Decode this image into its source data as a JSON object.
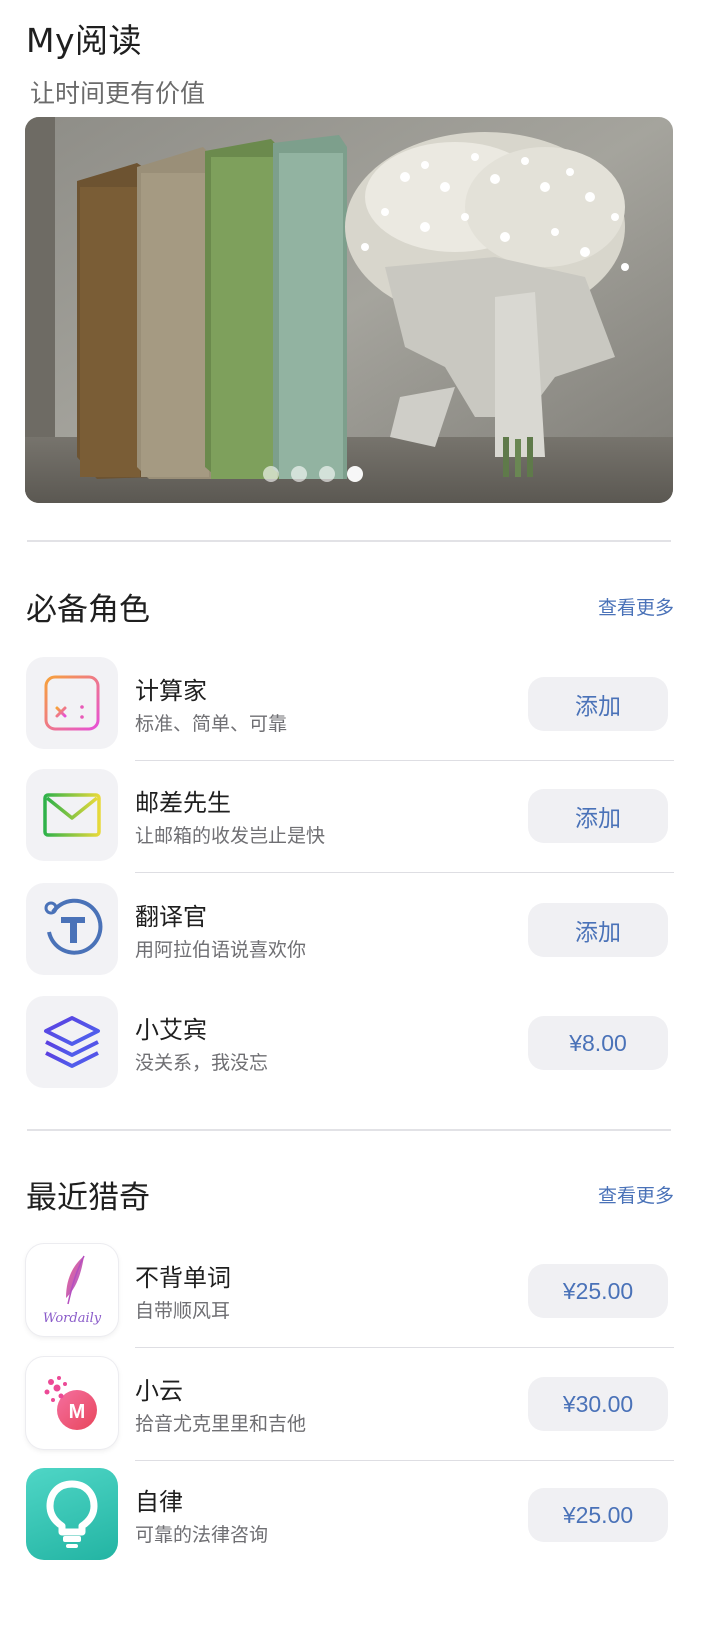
{
  "header": {
    "title": "My阅读",
    "subtitle": "让时间更有价值"
  },
  "banner": {
    "slides": 4,
    "active_slide": 4
  },
  "sections": [
    {
      "title": "必备角色",
      "more_label": "查看更多",
      "items": [
        {
          "name": "计算家",
          "desc": "标准、简单、可靠",
          "button": "添加",
          "icon": "calculator-icon"
        },
        {
          "name": "邮差先生",
          "desc": "让邮箱的收发岂止是快",
          "button": "添加",
          "icon": "mail-icon"
        },
        {
          "name": "翻译官",
          "desc": "用阿拉伯语说喜欢你",
          "button": "添加",
          "icon": "translate-icon"
        },
        {
          "name": "小艾宾",
          "desc": "没关系，我没忘",
          "button": "¥8.00",
          "icon": "layers-icon"
        }
      ]
    },
    {
      "title": "最近猎奇",
      "more_label": "查看更多",
      "items": [
        {
          "name": "不背单词",
          "desc": "自带顺风耳",
          "button": "¥25.00",
          "icon": "feather-icon",
          "logo_text": "Wordaily"
        },
        {
          "name": "小云",
          "desc": "拾音尤克里里和吉他",
          "button": "¥30.00",
          "icon": "music-m-icon",
          "logo_text": "M"
        },
        {
          "name": "自律",
          "desc": "可靠的法律咨询",
          "button": "¥25.00",
          "icon": "lightbulb-icon"
        }
      ]
    }
  ],
  "colors": {
    "accent": "#4a72b8",
    "button_bg": "#f0f0f3",
    "icon_bg": "#f2f2f5"
  }
}
